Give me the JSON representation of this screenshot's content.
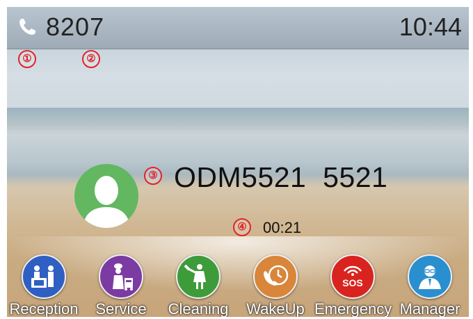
{
  "status_bar": {
    "icon": "phone-handset-icon",
    "account": "8207",
    "time": "10:44"
  },
  "callouts": [
    "①",
    "②",
    "③",
    "④"
  ],
  "call": {
    "avatar_icon": "person-avatar-icon",
    "caller": "ODM5521  5521",
    "duration": "00:21"
  },
  "dock": [
    {
      "label": "Reception",
      "icon": "reception-desk-icon",
      "color": "#2f5fc2"
    },
    {
      "label": "Service",
      "icon": "chef-service-icon",
      "color": "#7c3aa3"
    },
    {
      "label": "Cleaning",
      "icon": "cleaning-maid-icon",
      "color": "#3e9b3a"
    },
    {
      "label": "WakeUp",
      "icon": "wakeup-call-icon",
      "color": "#d9863a"
    },
    {
      "label": "Emergency",
      "icon": "sos-icon",
      "sos_text": "SOS",
      "color": "#d9231f"
    },
    {
      "label": "Manager",
      "icon": "manager-icon",
      "color": "#2a8fcf"
    }
  ]
}
